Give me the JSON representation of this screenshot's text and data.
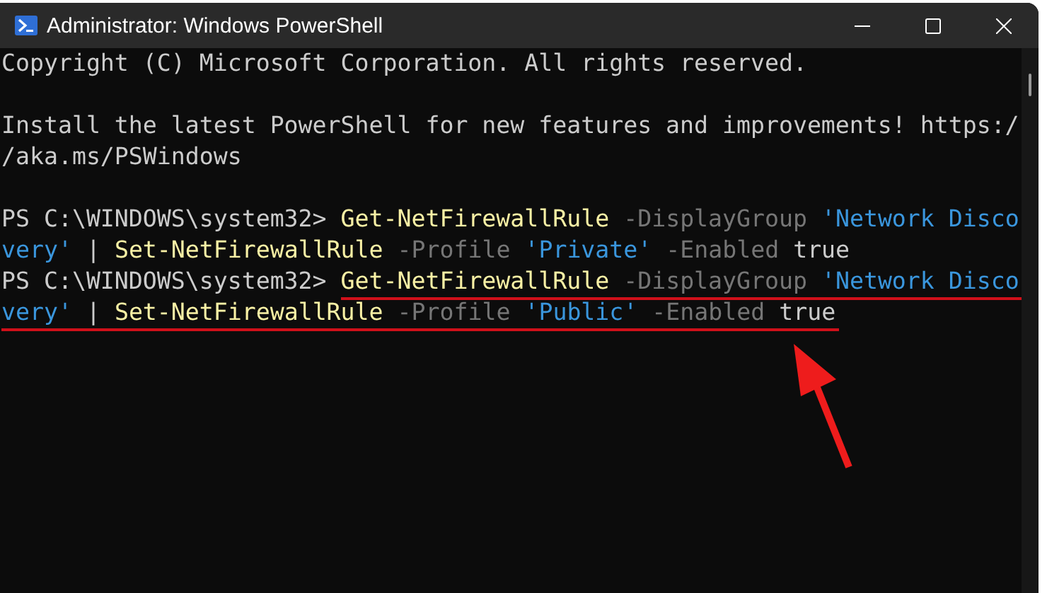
{
  "window": {
    "title": "Administrator: Windows PowerShell"
  },
  "lines": [
    {
      "underlined": false,
      "tokens": [
        {
          "kind": "plain",
          "text": "Copyright (C) Microsoft Corporation. All rights reserved."
        }
      ]
    },
    {
      "underlined": false
    },
    {
      "underlined": false,
      "tokens": [
        {
          "kind": "plain",
          "text": "Install the latest PowerShell for new features and improvements! https:/"
        }
      ]
    },
    {
      "underlined": false,
      "tokens": [
        {
          "kind": "plain",
          "text": "/aka.ms/PSWindows"
        }
      ]
    },
    {
      "underlined": false
    },
    {
      "underlined": false,
      "tokens": [
        {
          "kind": "prompt",
          "text": "PS C:\\WINDOWS\\system32>"
        },
        {
          "kind": "command",
          "text": "Get-NetFirewallRule"
        },
        {
          "kind": "parameter",
          "text": "-DisplayGroup"
        },
        {
          "kind": "string",
          "text": "'Network Disco"
        }
      ]
    },
    {
      "underlined": false,
      "tokens": [
        {
          "kind": "string",
          "text": "very'"
        },
        {
          "kind": "plain",
          "text": "|"
        },
        {
          "kind": "command",
          "text": "Set-NetFirewallRule"
        },
        {
          "kind": "parameter",
          "text": "-Profile"
        },
        {
          "kind": "string",
          "text": "'Private'"
        },
        {
          "kind": "parameter",
          "text": "-Enabled"
        },
        {
          "kind": "plain",
          "text": "true"
        }
      ]
    },
    {
      "underlined": true,
      "tokens": [
        {
          "kind": "prompt",
          "text": "PS C:\\WINDOWS\\system32>"
        },
        {
          "kind": "command",
          "text": "Get-NetFirewallRule"
        },
        {
          "kind": "parameter",
          "text": "-DisplayGroup"
        },
        {
          "kind": "string",
          "text": "'Network Disco"
        }
      ]
    },
    {
      "underlined": true,
      "tokens": [
        {
          "kind": "string",
          "text": "very'"
        },
        {
          "kind": "plain",
          "text": "|"
        },
        {
          "kind": "command",
          "text": "Set-NetFirewallRule"
        },
        {
          "kind": "parameter",
          "text": "-Profile"
        },
        {
          "kind": "string",
          "text": "'Public'"
        },
        {
          "kind": "parameter",
          "text": "-Enabled"
        },
        {
          "kind": "plain",
          "text": "true"
        }
      ]
    }
  ]
}
